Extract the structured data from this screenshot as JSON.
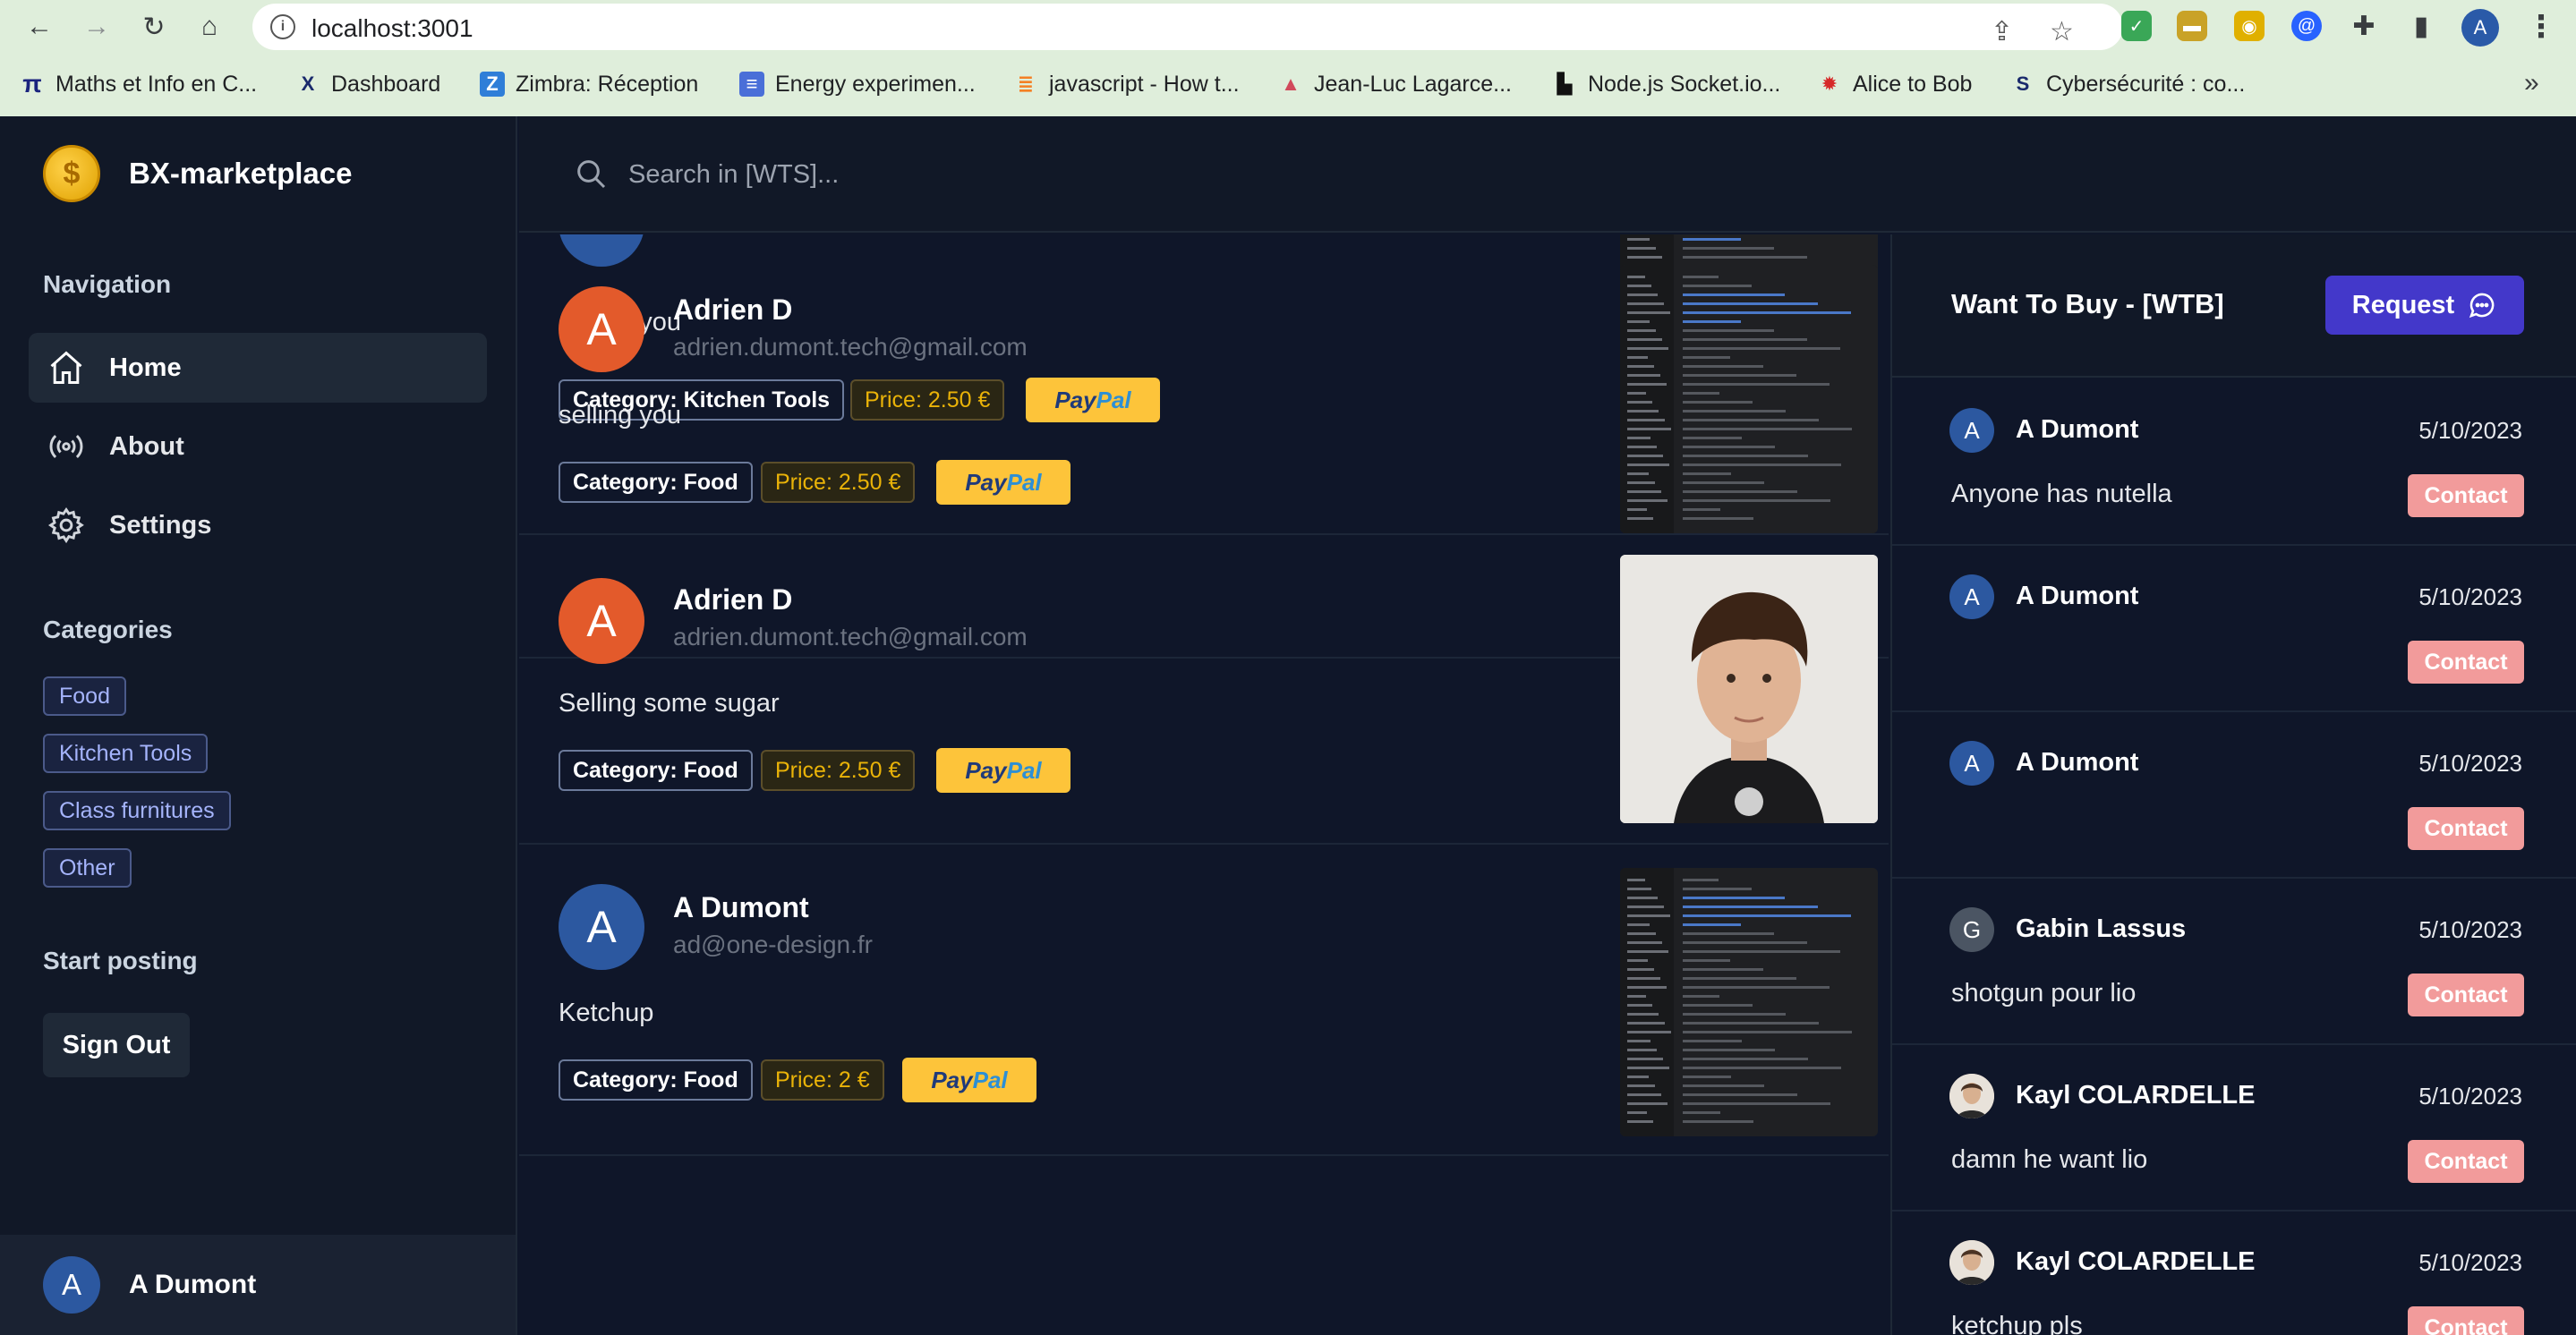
{
  "browser": {
    "url": "localhost:3001",
    "bookmarks": [
      {
        "label": "Maths et Info en C...",
        "icon": "pi-icon"
      },
      {
        "label": "Dashboard",
        "icon": "x-icon"
      },
      {
        "label": "Zimbra: Réception",
        "icon": "zimbra-icon"
      },
      {
        "label": "Energy experimen...",
        "icon": "doc-icon"
      },
      {
        "label": "javascript - How t...",
        "icon": "stackoverflow-icon"
      },
      {
        "label": "Jean-Luc Lagarce...",
        "icon": "triangle-icon"
      },
      {
        "label": "Node.js Socket.io...",
        "icon": "bookmark-black-icon"
      },
      {
        "label": "Alice to Bob",
        "icon": "sun-icon"
      },
      {
        "label": "Cybersécurité : co...",
        "icon": "cyber-icon"
      }
    ],
    "more": "»",
    "profile_initial": "A"
  },
  "app": {
    "name": "BX-marketplace",
    "search_placeholder": "Search in [WTS]..."
  },
  "sidebar": {
    "nav_title": "Navigation",
    "nav": [
      {
        "label": "Home",
        "active": true
      },
      {
        "label": "About",
        "active": false
      },
      {
        "label": "Settings",
        "active": false
      }
    ],
    "categories_title": "Categories",
    "categories": [
      "Food",
      "Kitchen Tools",
      "Class furnitures",
      "Other"
    ],
    "posting_title": "Start posting",
    "sign_out": "Sign Out",
    "user": {
      "initial": "A",
      "name": "A Dumont"
    }
  },
  "feed": {
    "posts": [
      {
        "name": "",
        "email": "",
        "text": "selling you",
        "category": "Category: Kitchen Tools",
        "price": "Price: 2.50 €",
        "avatar_color": "#2c58a0",
        "thumb": "code"
      },
      {
        "initial": "A",
        "name": "Adrien D",
        "email": "adrien.dumont.tech@gmail.com",
        "text": "selling you",
        "category": "Category: Food",
        "price": "Price: 2.50 €",
        "avatar_color": "#e35a2b",
        "thumb": "code"
      },
      {
        "initial": "A",
        "name": "Adrien D",
        "email": "adrien.dumont.tech@gmail.com",
        "text": "Selling some sugar",
        "category": "Category: Food",
        "price": "Price: 2.50 €",
        "avatar_color": "#e35a2b",
        "thumb": "portrait"
      },
      {
        "initial": "A",
        "name": "A Dumont",
        "email": "ad@one-design.fr",
        "text": "Ketchup",
        "category": "Category: Food",
        "price": "Price: 2 €",
        "avatar_color": "#2c58a0",
        "thumb": "code"
      }
    ],
    "paypal_a": "Pay",
    "paypal_b": "Pal"
  },
  "wtb": {
    "title": "Want To Buy - [WTB]",
    "request_label": "Request",
    "contact_label": "Contact",
    "items": [
      {
        "initial": "A",
        "name": "A Dumont",
        "date": "5/10/2023",
        "text": "Anyone has nutella",
        "avatar_color": "#2c58a0"
      },
      {
        "initial": "A",
        "name": "A Dumont",
        "date": "5/10/2023",
        "text": "",
        "avatar_color": "#2c58a0"
      },
      {
        "initial": "A",
        "name": "A Dumont",
        "date": "5/10/2023",
        "text": "",
        "avatar_color": "#2c58a0"
      },
      {
        "initial": "G",
        "name": "Gabin Lassus",
        "date": "5/10/2023",
        "text": "shotgun pour lio",
        "avatar_color": "#4b5563"
      },
      {
        "initial": "",
        "name": "Kayl COLARDELLE",
        "date": "5/10/2023",
        "text": "damn he want lio",
        "avatar_color": "#c9a98a"
      },
      {
        "initial": "",
        "name": "Kayl COLARDELLE",
        "date": "5/10/2023",
        "text": "ketchup pls",
        "avatar_color": "#c9a98a"
      }
    ]
  }
}
